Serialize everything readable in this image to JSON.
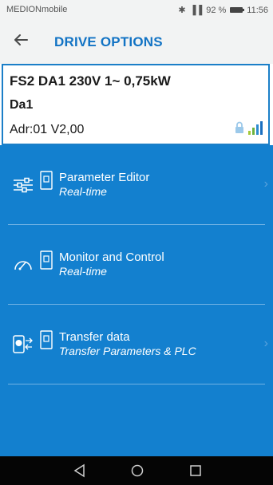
{
  "status_bar": {
    "carrier": "MEDIONmobile",
    "indicators": "✱ ⊑ ı☐ı ⁴ᴳ.❙ 92 %",
    "battery_percent": "92 %",
    "time": "11:56"
  },
  "app_bar": {
    "title": "DRIVE OPTIONS",
    "back_icon": "arrow-left-icon"
  },
  "device": {
    "name": "FS2 DA1 230V 1~ 0,75kW",
    "short_name": "Da1",
    "address": "Adr:01 V2,00",
    "lock_icon": "lock-icon",
    "signal_icon": "signal-bars-icon"
  },
  "menu": {
    "items": [
      {
        "label": "Parameter Editor",
        "sub": "Real-time",
        "icon": "sliders-icon"
      },
      {
        "label": "Monitor and Control",
        "sub": "Real-time",
        "icon": "gauge-icon"
      },
      {
        "label": "Transfer data",
        "sub": "Transfer Parameters & PLC",
        "icon": "phone-transfer-icon"
      }
    ]
  },
  "colors": {
    "accent": "#1273c4",
    "menu_background": "#1380cf",
    "device_border": "#1b7fc8",
    "appbar_background": "#f2f3f3",
    "navbar_background": "#050505"
  }
}
